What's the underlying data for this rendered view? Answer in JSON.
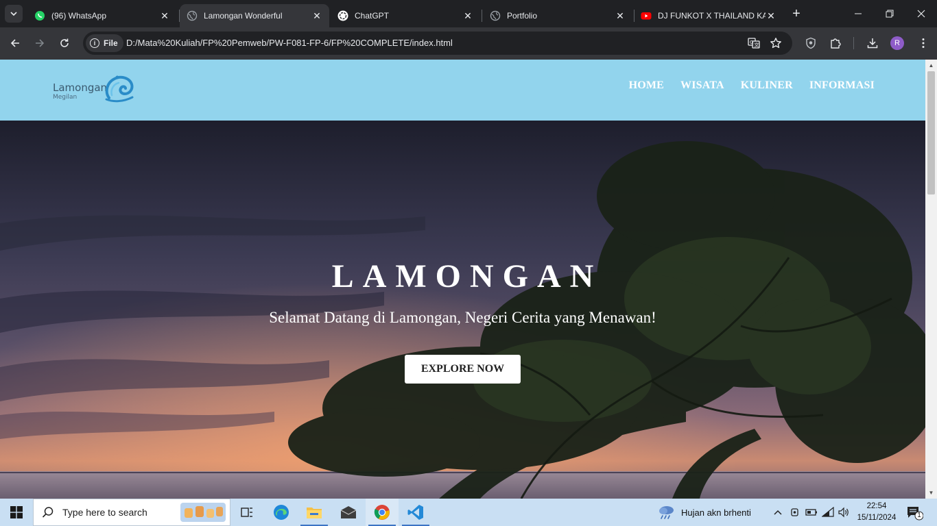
{
  "browser": {
    "tabs": [
      {
        "title": "(96) WhatsApp",
        "icon": "whatsapp-icon",
        "active": false
      },
      {
        "title": "Lamongan Wonderful",
        "icon": "globe-icon",
        "active": true
      },
      {
        "title": "ChatGPT",
        "icon": "chatgpt-icon",
        "active": false
      },
      {
        "title": "Portfolio",
        "icon": "globe-icon",
        "active": false
      },
      {
        "title": "DJ FUNKOT X THAILAND KA",
        "icon": "youtube-icon",
        "active": false
      }
    ],
    "address": {
      "scheme_label": "File",
      "url": "D:/Mata%20Kuliah/FP%20Pemweb/PW-F081-FP-6/FP%20COMPLETE/index.html"
    },
    "profile_initial": "R"
  },
  "site": {
    "logo_text": "Lamongan",
    "logo_sub": "Megilan",
    "nav": [
      "HOME",
      "WISATA",
      "KULINER",
      "INFORMASI"
    ],
    "hero": {
      "title": "LAMONGAN",
      "subtitle": "Selamat Datang di Lamongan, Negeri Cerita yang Menawan!",
      "cta": "EXPLORE NOW"
    }
  },
  "taskbar": {
    "search_placeholder": "Type here to search",
    "weather_text": "Hujan akn brhenti",
    "time": "22:54",
    "date": "15/11/2024",
    "notification_count": "1"
  },
  "colors": {
    "header_bg": "#92d4ed",
    "chrome_dark": "#202124",
    "chrome_toolbar": "#35363a",
    "taskbar_bg": "#c9dff3"
  }
}
